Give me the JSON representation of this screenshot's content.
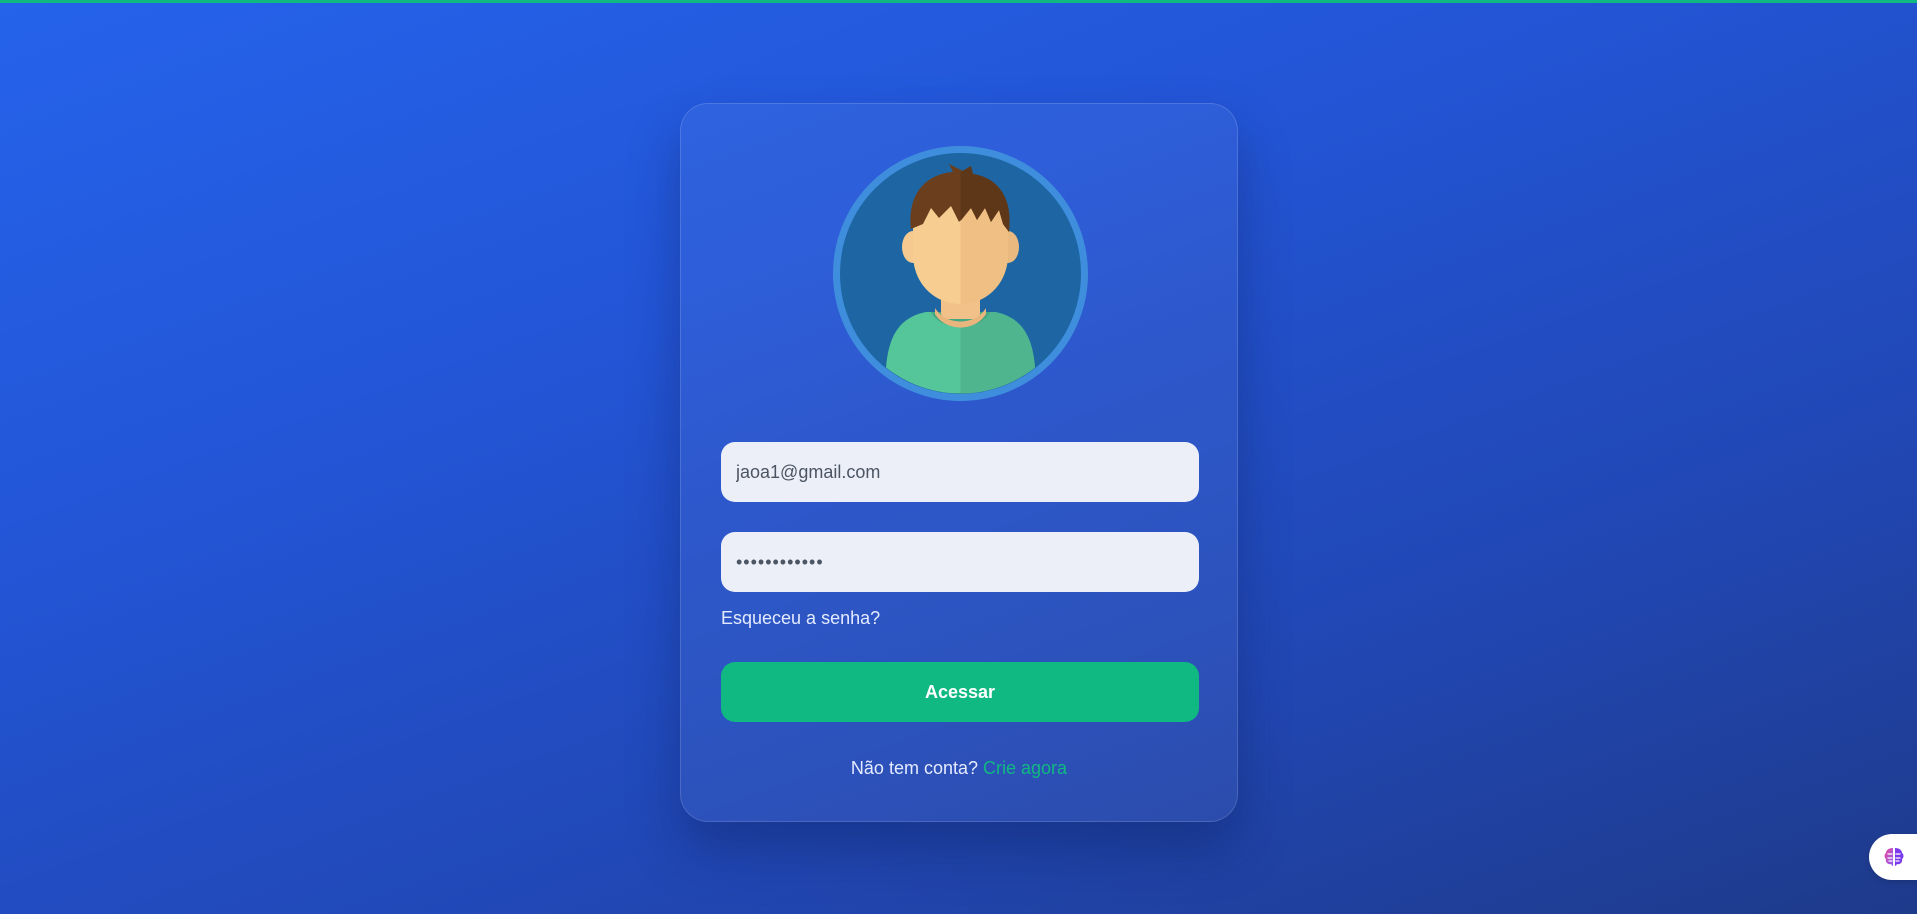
{
  "login": {
    "avatar": "user-avatar-illustration",
    "email_value": "jaoa1@gmail.com",
    "password_value": "••••••••••••",
    "forgot_password": "Esqueceu a senha?",
    "submit_label": "Acessar",
    "signup_prompt": "Não tem conta?",
    "signup_link": "Crie agora"
  },
  "widget": {
    "icon": "brain-icon"
  },
  "colors": {
    "background_start": "#2563eb",
    "background_end": "#1e3a8a",
    "accent": "#10b981",
    "input_background": "#eceff8"
  }
}
